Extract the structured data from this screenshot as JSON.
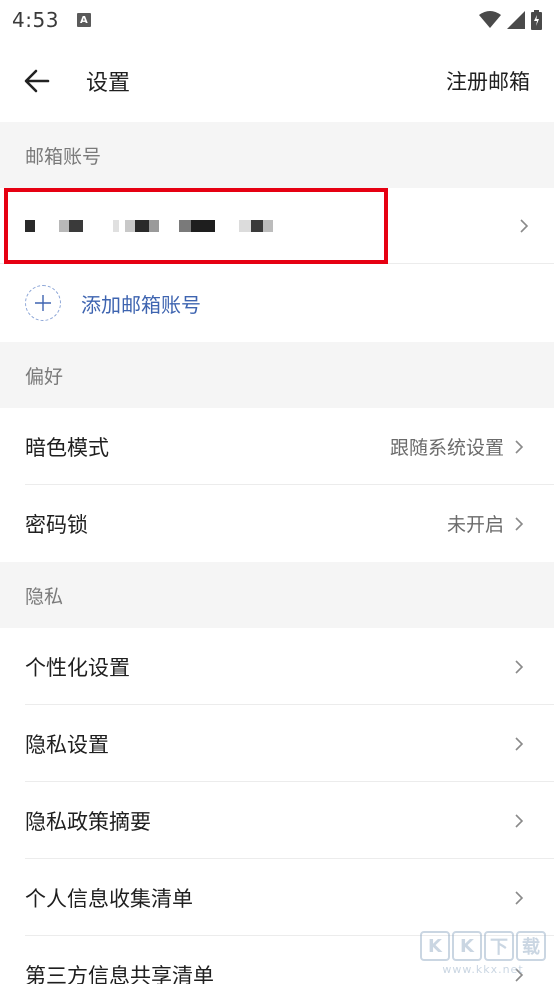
{
  "status_bar": {
    "time": "4:53",
    "notif_letter": "A"
  },
  "header": {
    "title": "设置",
    "action": "注册邮箱"
  },
  "sections": {
    "mailbox": {
      "title": "邮箱账号",
      "add_label": "添加邮箱账号"
    },
    "preferences": {
      "title": "偏好",
      "items": [
        {
          "label": "暗色模式",
          "value": "跟随系统设置"
        },
        {
          "label": "密码锁",
          "value": "未开启"
        }
      ]
    },
    "privacy": {
      "title": "隐私",
      "items": [
        {
          "label": "个性化设置"
        },
        {
          "label": "隐私设置"
        },
        {
          "label": "隐私政策摘要"
        },
        {
          "label": "个人信息收集清单"
        },
        {
          "label": "第三方信息共享清单"
        }
      ]
    }
  },
  "watermark": {
    "chars": [
      "K",
      "K",
      "下",
      "载"
    ],
    "url": "www.kkx.net"
  },
  "colors": {
    "accent_blue": "#3e64b0",
    "highlight_red": "#e60012",
    "section_bg": "#f5f5f5"
  }
}
